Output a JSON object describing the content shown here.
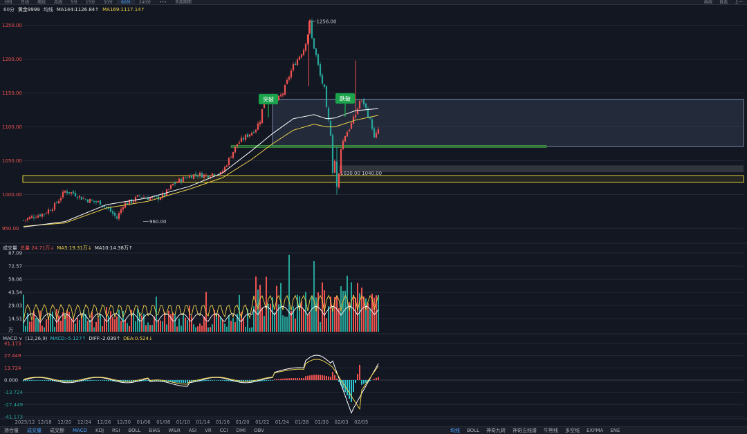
{
  "top_tabs": [
    "分时",
    "日线",
    "周线",
    "月线",
    "5分",
    "15分",
    "30分",
    "60分",
    "240分",
    "•••",
    "多周期图"
  ],
  "top_tabs_active": 7,
  "top_right": [
    "画线",
    "自选",
    "上一"
  ],
  "info": {
    "period": "60分",
    "symbol": "黄金9999",
    "line_type": "均线",
    "ma144": "MA144:1126.84↑",
    "ma169": "MA169:1117.14↑"
  },
  "volume_header": {
    "title": "成交量",
    "total": "总量:24.71万↓",
    "ma5": "MA5:19.31万↓",
    "ma10": "MA10:14.38万↑"
  },
  "macd_header": {
    "title": "MACD ∨",
    "params": "(12,26,9)",
    "macd": "MACD:-5.127↑",
    "diff": "DIFF:-2.039↑",
    "dea": "DEA:0.524↓"
  },
  "bottom_tabs": [
    "持仓量",
    "成交量",
    "成交额",
    "MACD",
    "KDJ",
    "RSI",
    "BOLL",
    "BIAS",
    "W&R",
    "ASI",
    "VR",
    "CCI",
    "DMI",
    "OBV"
  ],
  "bottom_tabs_active": [
    1,
    3
  ],
  "right_tabs": [
    "均线",
    "BOLL",
    "神奇九转",
    "神奇五线谱",
    "牛熊线",
    "多空线",
    "EXPMA",
    "ENE"
  ],
  "right_tabs_active": 0,
  "colors": {
    "background": "#131722",
    "up": "#ef5350",
    "down": "#26a69a",
    "ma144": "#ffffff",
    "ma169": "#f0d24a",
    "zone": "#38445a",
    "annotation": "#1aa34a"
  },
  "chart_data": [
    {
      "type": "candlestick",
      "ylim": [
        930,
        1265
      ],
      "y_ticks": [
        "1250.00",
        "1200.00",
        "1150.00",
        "1100.00",
        "1050.00",
        "1000.00",
        "950.00"
      ],
      "x_ticks": [
        "2025/12",
        "12/18",
        "12/20",
        "12/24",
        "12/26",
        "12/30",
        "01/06",
        "01/08",
        "01/10",
        "01/14",
        "01/16",
        "01/20",
        "01/22",
        "01/24",
        "01/28",
        "01/30",
        "02/03",
        "02/05"
      ],
      "high_label": "1256.00",
      "low_label": "960.00",
      "zone_label": "1030.00  1040.00",
      "annotations": [
        "突破",
        "跌破"
      ],
      "close_path": [
        [
          0,
          962
        ],
        [
          5,
          968
        ],
        [
          10,
          972
        ],
        [
          15,
          984
        ],
        [
          20,
          1005
        ],
        [
          24,
          1002
        ],
        [
          28,
          995
        ],
        [
          33,
          990
        ],
        [
          37,
          988
        ],
        [
          42,
          975
        ],
        [
          45,
          965
        ],
        [
          48,
          985
        ],
        [
          52,
          990
        ],
        [
          56,
          998
        ],
        [
          60,
          995
        ],
        [
          64,
          994
        ],
        [
          68,
          1000
        ],
        [
          72,
          1015
        ],
        [
          76,
          1022
        ],
        [
          80,
          1028
        ],
        [
          84,
          1030
        ],
        [
          88,
          1028
        ],
        [
          92,
          1032
        ],
        [
          95,
          1030
        ],
        [
          97,
          1040
        ],
        [
          100,
          1058
        ],
        [
          103,
          1075
        ],
        [
          105,
          1080
        ],
        [
          108,
          1088
        ],
        [
          110,
          1092
        ],
        [
          112,
          1098
        ],
        [
          114,
          1110
        ],
        [
          116,
          1140
        ],
        [
          118,
          1145
        ],
        [
          120,
          1142
        ],
        [
          122,
          1138
        ],
        [
          125,
          1150
        ],
        [
          128,
          1175
        ],
        [
          130,
          1190
        ],
        [
          133,
          1205
        ],
        [
          135,
          1215
        ],
        [
          137,
          1238
        ],
        [
          138,
          1255
        ],
        [
          139,
          1230
        ],
        [
          141,
          1205
        ],
        [
          143,
          1175
        ],
        [
          145,
          1155
        ],
        [
          146,
          1125
        ],
        [
          148,
          1090
        ],
        [
          149,
          1035
        ],
        [
          150,
          1050
        ],
        [
          151,
          1010
        ],
        [
          152,
          1030
        ],
        [
          153,
          1070
        ],
        [
          155,
          1088
        ],
        [
          157,
          1098
        ],
        [
          160,
          1118
        ],
        [
          162,
          1138
        ],
        [
          164,
          1135
        ],
        [
          166,
          1118
        ],
        [
          168,
          1100
        ],
        [
          169,
          1082
        ],
        [
          170,
          1088
        ],
        [
          171,
          1096
        ]
      ],
      "ma144": [
        [
          0,
          952
        ],
        [
          20,
          960
        ],
        [
          40,
          985
        ],
        [
          60,
          995
        ],
        [
          80,
          1012
        ],
        [
          96,
          1032
        ],
        [
          110,
          1065
        ],
        [
          120,
          1090
        ],
        [
          130,
          1112
        ],
        [
          140,
          1118
        ],
        [
          146,
          1112
        ],
        [
          150,
          1113
        ],
        [
          160,
          1124
        ],
        [
          171,
          1127
        ]
      ],
      "ma169": [
        [
          0,
          953
        ],
        [
          20,
          958
        ],
        [
          40,
          980
        ],
        [
          60,
          990
        ],
        [
          80,
          1008
        ],
        [
          96,
          1025
        ],
        [
          110,
          1052
        ],
        [
          120,
          1075
        ],
        [
          130,
          1095
        ],
        [
          140,
          1104
        ],
        [
          146,
          1100
        ],
        [
          150,
          1100
        ],
        [
          160,
          1110
        ],
        [
          171,
          1117
        ]
      ],
      "zones": [
        {
          "kind": "box",
          "from": 1071,
          "to": 1141,
          "x_start": 120
        },
        {
          "kind": "line",
          "value": 1071,
          "x_start": 100,
          "x_end": 252
        },
        {
          "kind": "band",
          "from": 1018,
          "to": 1028
        },
        {
          "kind": "gray",
          "from": 1033,
          "to": 1043,
          "x_start": 152
        }
      ]
    },
    {
      "type": "bar",
      "name": "volume",
      "y_ticks": [
        "87.09",
        "72.57",
        "58.06",
        "43.54",
        "29.03",
        "14.51",
        "万"
      ],
      "ylim": [
        0,
        87.09
      ]
    },
    {
      "type": "bar",
      "name": "MACD",
      "y_ticks": [
        "41.173",
        "27.449",
        "13.724",
        "0.000",
        "-13.724",
        "-27.449",
        "-41.173"
      ],
      "ylim": [
        -41.173,
        41.173
      ],
      "labels": [
        "DIFF",
        "DEA"
      ]
    }
  ]
}
